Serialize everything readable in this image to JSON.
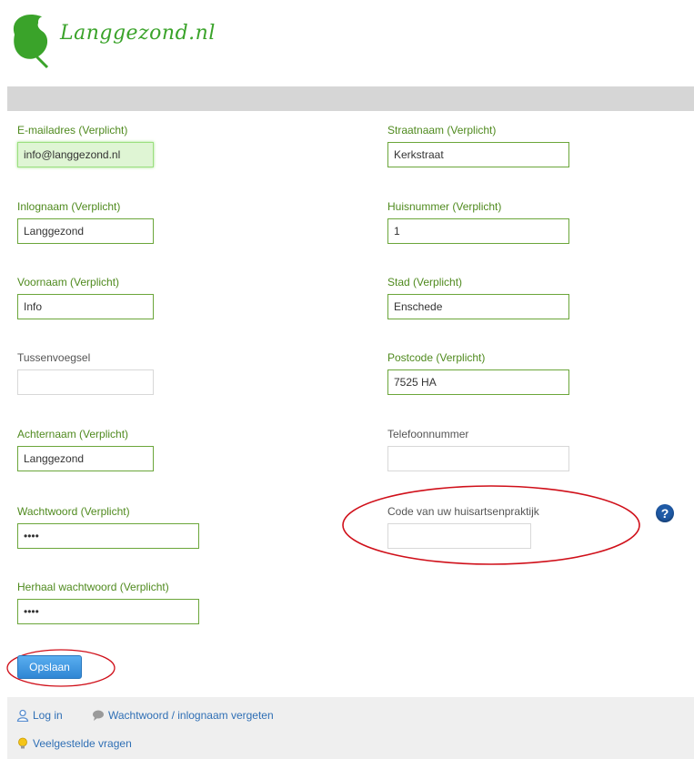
{
  "brand": {
    "name": "Langgezond.nl"
  },
  "form": {
    "left_fields": [
      {
        "label": "E-mailadres (Verplicht)",
        "value": "info@langgezond.nl"
      },
      {
        "label": "Inlognaam (Verplicht)",
        "value": "Langgezond"
      },
      {
        "label": "Voornaam (Verplicht)",
        "value": "Info"
      },
      {
        "label": "Tussenvoegsel",
        "value": ""
      },
      {
        "label": "Achternaam (Verplicht)",
        "value": "Langgezond"
      },
      {
        "label": "Wachtwoord (Verplicht)",
        "value": "••••"
      },
      {
        "label": "Herhaal wachtwoord (Verplicht)",
        "value": "••••"
      }
    ],
    "right_fields": [
      {
        "label": "Straatnaam (Verplicht)",
        "value": "Kerkstraat"
      },
      {
        "label": "Huisnummer (Verplicht)",
        "value": "1"
      },
      {
        "label": "Stad (Verplicht)",
        "value": "Enschede"
      },
      {
        "label": "Postcode (Verplicht)",
        "value": "7525 HA"
      },
      {
        "label": "Telefoonnummer",
        "value": ""
      },
      {
        "label": "Code van uw huisartsenpraktijk",
        "value": ""
      }
    ],
    "help_icon_text": "?",
    "save_label": "Opslaan"
  },
  "footer": {
    "login_label": "Log in",
    "forgot_label": "Wachtwoord / inlognaam vergeten",
    "faq_label": "Veelgestelde vragen"
  },
  "colors": {
    "required_label": "#4f8a1e",
    "input_border": "#6ba63a",
    "focused_bg": "#dff5d4",
    "button_blue": "#2f86d4",
    "annotation_red": "#d0101a",
    "brand_green": "#3aa32a"
  }
}
